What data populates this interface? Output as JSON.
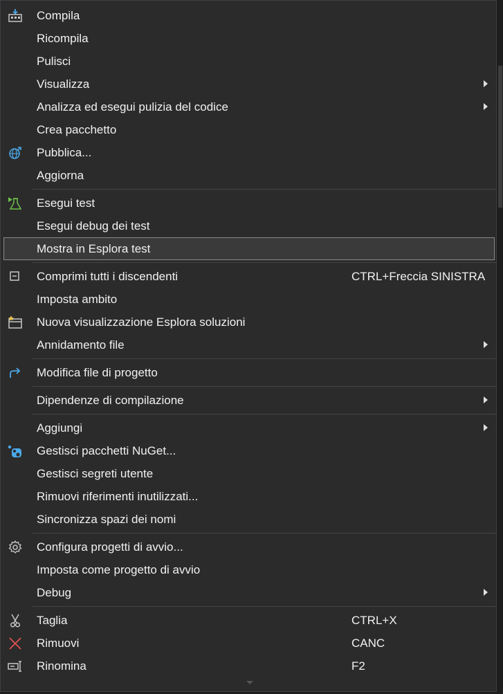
{
  "menu": {
    "groups": [
      [
        {
          "label": "Compila",
          "icon": "build-icon"
        },
        {
          "label": "Ricompila"
        },
        {
          "label": "Pulisci"
        },
        {
          "label": "Visualizza",
          "submenu": true
        },
        {
          "label": "Analizza ed esegui pulizia del codice",
          "submenu": true
        },
        {
          "label": "Crea pacchetto"
        },
        {
          "label": "Pubblica...",
          "icon": "publish-globe-icon"
        },
        {
          "label": "Aggiorna"
        }
      ],
      [
        {
          "label": "Esegui test",
          "icon": "run-tests-icon"
        },
        {
          "label": "Esegui debug dei test"
        },
        {
          "label": "Mostra in Esplora test",
          "selected": true
        }
      ],
      [
        {
          "label": "Comprimi tutti i discendenti",
          "shortcut": "CTRL+Freccia SINISTRA",
          "icon": "collapse-all-icon"
        },
        {
          "label": "Imposta ambito"
        },
        {
          "label": "Nuova visualizzazione Esplora soluzioni",
          "icon": "new-view-icon"
        },
        {
          "label": "Annidamento file",
          "submenu": true
        }
      ],
      [
        {
          "label": "Modifica file di progetto",
          "icon": "edit-project-arrow-icon"
        }
      ],
      [
        {
          "label": "Dipendenze di compilazione",
          "submenu": true
        }
      ],
      [
        {
          "label": "Aggiungi",
          "submenu": true
        },
        {
          "label": "Gestisci pacchetti NuGet...",
          "icon": "nuget-icon"
        },
        {
          "label": "Gestisci segreti utente"
        },
        {
          "label": "Rimuovi riferimenti inutilizzati..."
        },
        {
          "label": "Sincronizza spazi dei nomi"
        }
      ],
      [
        {
          "label": "Configura progetti di avvio...",
          "icon": "gear-icon"
        },
        {
          "label": "Imposta come progetto di avvio"
        },
        {
          "label": "Debug",
          "submenu": true
        }
      ],
      [
        {
          "label": "Taglia",
          "shortcut": "CTRL+X",
          "icon": "scissors-icon"
        },
        {
          "label": "Rimuovi",
          "shortcut": "CANC",
          "icon": "delete-x-icon"
        },
        {
          "label": "Rinomina",
          "shortcut": "F2",
          "icon": "rename-icon"
        }
      ]
    ]
  },
  "colors": {
    "background": "#2b2b2b",
    "text": "#f1f1f1",
    "selected": "#3a3a3a",
    "separator": "#454545",
    "accent_blue": "#4aa8e8",
    "accent_green": "#6cc04a",
    "delete_red": "#e05252"
  }
}
